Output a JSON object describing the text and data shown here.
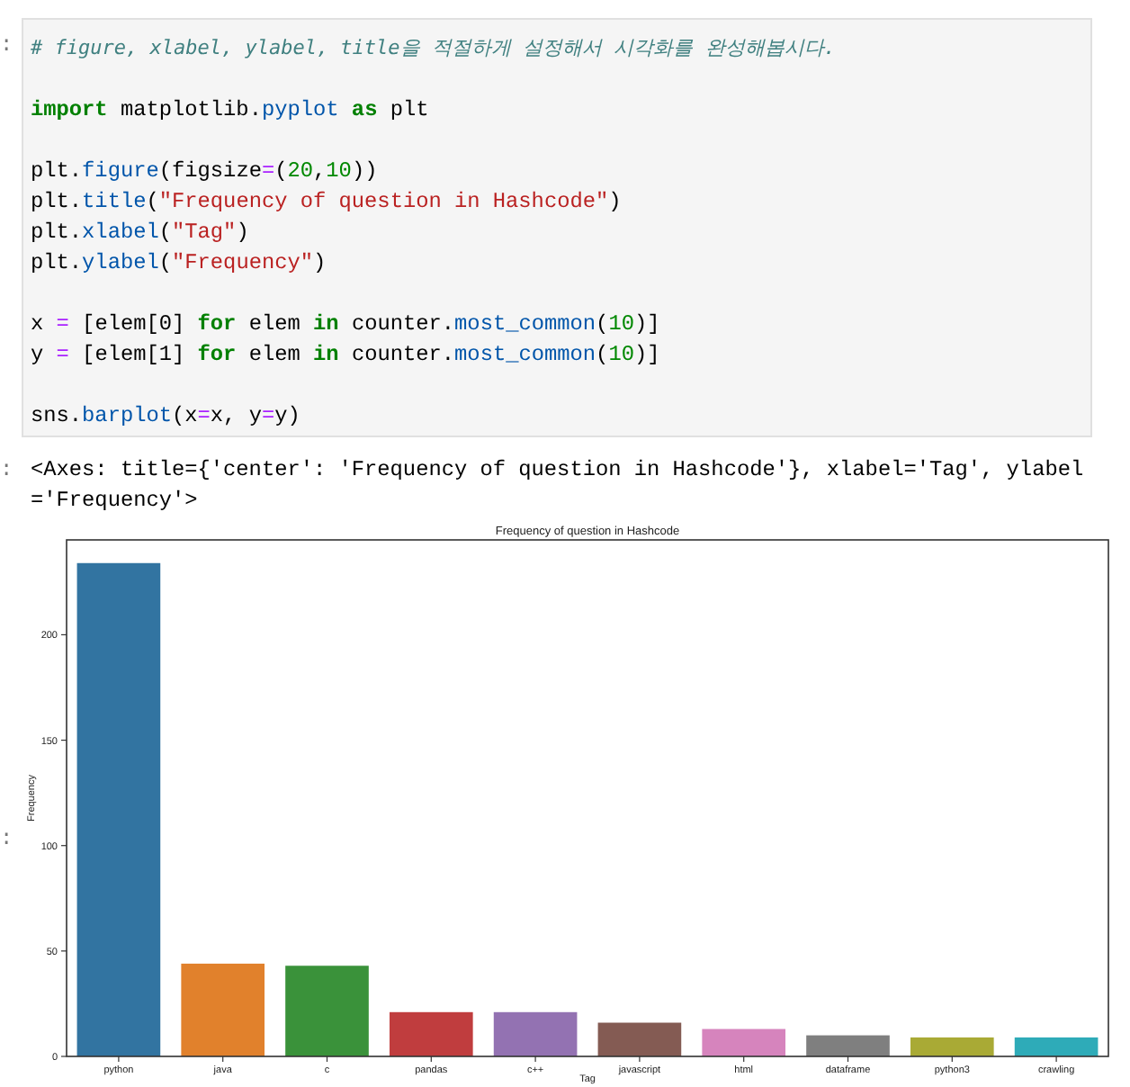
{
  "code_cell": {
    "prompt": ":",
    "blocks": [
      [
        [
          {
            "kind": "comment",
            "text": "# figure, xlabel, ylabel, title을 적절하게 설정해서 시각화를 완성해봅시다."
          }
        ]
      ],
      [
        [
          {
            "kind": "kw",
            "text": "import"
          },
          {
            "kind": "plain",
            "text": " matplotlib."
          },
          {
            "kind": "attr",
            "text": "pyplot"
          },
          {
            "kind": "kw",
            "text": " as"
          },
          {
            "kind": "plain",
            "text": " plt"
          }
        ]
      ],
      [
        [
          {
            "kind": "plain",
            "text": "plt."
          },
          {
            "kind": "attr",
            "text": "figure"
          },
          {
            "kind": "plain",
            "text": "(figsize"
          },
          {
            "kind": "op",
            "text": "="
          },
          {
            "kind": "plain",
            "text": "("
          },
          {
            "kind": "num",
            "text": "20"
          },
          {
            "kind": "plain",
            "text": ","
          },
          {
            "kind": "num",
            "text": "10"
          },
          {
            "kind": "plain",
            "text": "))"
          }
        ],
        [
          {
            "kind": "plain",
            "text": "plt."
          },
          {
            "kind": "attr",
            "text": "title"
          },
          {
            "kind": "plain",
            "text": "("
          },
          {
            "kind": "str",
            "text": "\"Frequency of question in Hashcode\""
          },
          {
            "kind": "plain",
            "text": ")"
          }
        ],
        [
          {
            "kind": "plain",
            "text": "plt."
          },
          {
            "kind": "attr",
            "text": "xlabel"
          },
          {
            "kind": "plain",
            "text": "("
          },
          {
            "kind": "str",
            "text": "\"Tag\""
          },
          {
            "kind": "plain",
            "text": ")"
          }
        ],
        [
          {
            "kind": "plain",
            "text": "plt."
          },
          {
            "kind": "attr",
            "text": "ylabel"
          },
          {
            "kind": "plain",
            "text": "("
          },
          {
            "kind": "str",
            "text": "\"Frequency\""
          },
          {
            "kind": "plain",
            "text": ")"
          }
        ]
      ],
      [
        [
          {
            "kind": "plain",
            "text": "x "
          },
          {
            "kind": "op",
            "text": "="
          },
          {
            "kind": "plain",
            "text": " [elem[0] "
          },
          {
            "kind": "kw",
            "text": "for"
          },
          {
            "kind": "plain",
            "text": " elem "
          },
          {
            "kind": "kw",
            "text": "in"
          },
          {
            "kind": "plain",
            "text": " counter."
          },
          {
            "kind": "attr",
            "text": "most_common"
          },
          {
            "kind": "plain",
            "text": "("
          },
          {
            "kind": "num",
            "text": "10"
          },
          {
            "kind": "plain",
            "text": ")]"
          }
        ],
        [
          {
            "kind": "plain",
            "text": "y "
          },
          {
            "kind": "op",
            "text": "="
          },
          {
            "kind": "plain",
            "text": " [elem[1] "
          },
          {
            "kind": "kw",
            "text": "for"
          },
          {
            "kind": "plain",
            "text": " elem "
          },
          {
            "kind": "kw",
            "text": "in"
          },
          {
            "kind": "plain",
            "text": " counter."
          },
          {
            "kind": "attr",
            "text": "most_common"
          },
          {
            "kind": "plain",
            "text": "("
          },
          {
            "kind": "num",
            "text": "10"
          },
          {
            "kind": "plain",
            "text": ")]"
          }
        ]
      ],
      [
        [
          {
            "kind": "plain",
            "text": "sns."
          },
          {
            "kind": "attr",
            "text": "barplot"
          },
          {
            "kind": "plain",
            "text": "(x"
          },
          {
            "kind": "op",
            "text": "="
          },
          {
            "kind": "plain",
            "text": "x, y"
          },
          {
            "kind": "op",
            "text": "="
          },
          {
            "kind": "plain",
            "text": "y)"
          }
        ]
      ]
    ]
  },
  "output": {
    "prompt": ":",
    "text": "<Axes: title={'center': 'Frequency of question in Hashcode'}, xlabel='Tag', ylabel='Frequency'>",
    "figure_prompt": ":",
    "chart_data": {
      "type": "bar",
      "title": "Frequency of question in Hashcode",
      "xlabel": "Tag",
      "ylabel": "Frequency",
      "categories": [
        "python",
        "java",
        "c",
        "pandas",
        "c++",
        "javascript",
        "html",
        "dataframe",
        "python3",
        "crawling"
      ],
      "values": [
        234,
        44,
        43,
        21,
        21,
        16,
        13,
        10,
        9,
        9
      ],
      "colors": [
        "#3274a1",
        "#e1812c",
        "#3a923a",
        "#c03d3e",
        "#9372b2",
        "#845b53",
        "#d684bd",
        "#7f7f7f",
        "#a9aa35",
        "#2eabb8"
      ],
      "ylim": [
        0,
        245
      ],
      "yticks": [
        0,
        50,
        100,
        150,
        200
      ]
    }
  }
}
